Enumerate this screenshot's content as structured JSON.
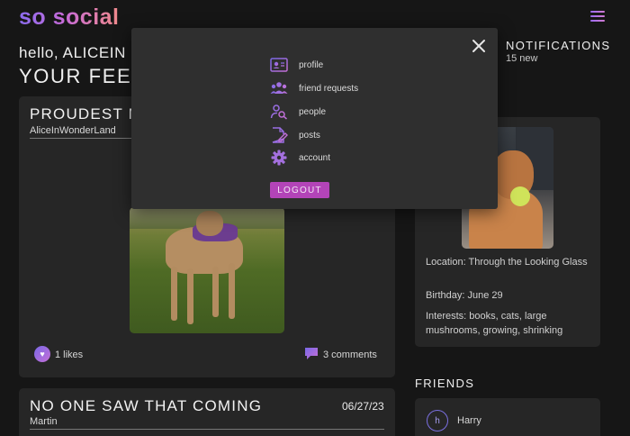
{
  "app": {
    "logo": "so social"
  },
  "feed": {
    "greeting": "hello, ALICEIN",
    "title": "YOUR FEED",
    "posts": [
      {
        "title": "PROUDEST M",
        "author": "AliceInWonderLand",
        "likes_label": "1 likes",
        "comments_label": "3 comments"
      },
      {
        "title": "NO ONE SAW THAT COMING",
        "author": "Martin",
        "date": "06/27/23"
      }
    ]
  },
  "notifications": {
    "title": "NOTIFICATIONS",
    "count_label": "15 new"
  },
  "profile": {
    "location": "Location: Through the Looking Glass",
    "birthday": "Birthday: June 29",
    "interests": "Interests: books, cats, large mushrooms, growing, shrinking"
  },
  "friends": {
    "title": "FRIENDS",
    "items": [
      {
        "initial": "h",
        "name": "Harry"
      }
    ]
  },
  "menu": {
    "items": [
      {
        "label": "profile",
        "icon": "id-card-icon"
      },
      {
        "label": "friend requests",
        "icon": "users-group-icon"
      },
      {
        "label": "people",
        "icon": "user-search-icon"
      },
      {
        "label": "posts",
        "icon": "document-edit-icon"
      },
      {
        "label": "account",
        "icon": "gear-icon"
      }
    ],
    "logout_label": "LOGOUT",
    "close_icon": "close-icon"
  },
  "colors": {
    "accent_purple": "#8b6cf0",
    "accent_pink": "#c76bd8",
    "logout_bg": "#b344b8"
  }
}
